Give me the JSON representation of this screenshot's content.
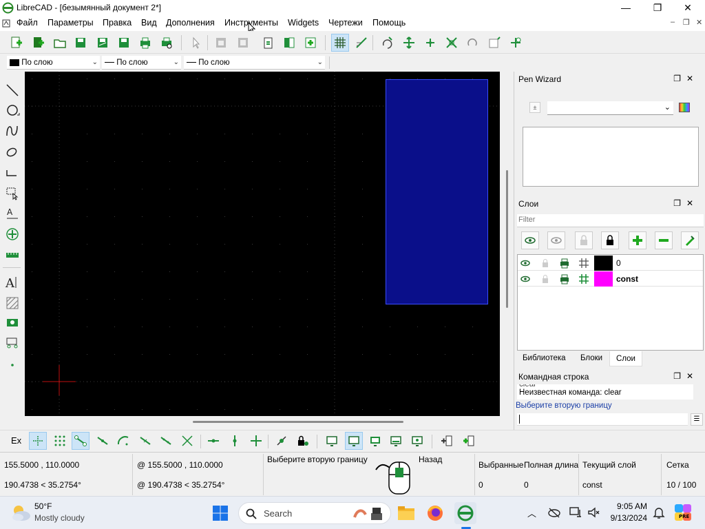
{
  "window": {
    "title": "LibreCAD - [безымянный документ 2*]",
    "controls": {
      "minimize": "—",
      "maximize": "❐",
      "close": "✕"
    }
  },
  "menu": {
    "items": [
      "Файл",
      "Параметры",
      "Правка",
      "Вид",
      "Дополнения",
      "Инструменты",
      "Widgets",
      "Чертежи",
      "Помощь"
    ],
    "mdi_controls": [
      "–",
      "❐",
      "✕"
    ]
  },
  "pen_toolbar": {
    "color": "По слою",
    "width": "По слою",
    "linetype": "По слою"
  },
  "pen_wizard": {
    "title": "Pen Wizard",
    "spin_label": "±"
  },
  "layers": {
    "title": "Слои",
    "filter_placeholder": "Filter",
    "rows": [
      {
        "name": "0",
        "color": "#000000",
        "bold": false
      },
      {
        "name": "const",
        "color": "#ff00ff",
        "bold": true
      }
    ],
    "tabs": [
      "Библиотека",
      "Блоки",
      "Слои"
    ],
    "active_tab": "Слои"
  },
  "command_line": {
    "title": "Командная строка",
    "history_cut": "clear",
    "history": "Неизвестная команда: clear",
    "prompt": "Выберите вторую границу"
  },
  "bottom_tools": {
    "ex_label": "Ex"
  },
  "status": {
    "abs_coord": "155.5000 , 110.0000",
    "abs_polar": "190.4738 < 35.2754°",
    "rel_coord": "@  155.5000 , 110.0000",
    "rel_polar": "@  190.4738 < 35.2754°",
    "hint_left": "Выберите вторую границу",
    "hint_right": "Назад",
    "selected_label": "Выбранные",
    "selected_value": "0",
    "total_length_label": "Полная длина",
    "total_length_value": "0",
    "current_layer_label": "Текущий слой",
    "current_layer_value": "const",
    "grid_label": "Сетка",
    "grid_value": "10 / 100"
  },
  "taskbar": {
    "weather_temp": "50°F",
    "weather_desc": "Mostly cloudy",
    "search_label": "Search",
    "time": "9:05 AM",
    "date": "9/13/2024"
  },
  "colors": {
    "canvas_bg": "#000000",
    "selection_fill": "#0a0f8a",
    "selection_border": "#3a4dff",
    "layer_const": "#ff00ff",
    "accent_green": "#1f8f3a"
  }
}
